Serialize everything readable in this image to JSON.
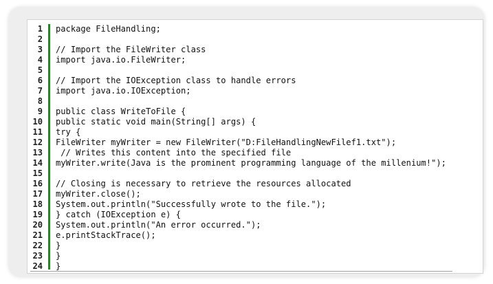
{
  "colors": {
    "frame_background": "#eeeeee",
    "code_background": "#ffffff",
    "gutter_separator": "#2e7d32",
    "text": "#111111"
  },
  "code": {
    "language": "java",
    "line_numbers": [
      "1",
      "2",
      "3",
      "4",
      "5",
      "6",
      "7",
      "8",
      "9",
      "10",
      "11",
      "12",
      "13",
      "14",
      "15",
      "16",
      "17",
      "18",
      "19",
      "20",
      "21",
      "22",
      "23",
      "24"
    ],
    "lines": [
      "package FileHandling;",
      "",
      "// Import the FileWriter class",
      "import java.io.FileWriter;",
      "",
      "// Import the IOException class to handle errors",
      "import java.io.IOException;",
      "",
      "public class WriteToFile {",
      "public static void main(String[] args) {",
      "try {",
      "FileWriter myWriter = new FileWriter(\"D:FileHandlingNewFilef1.txt\");",
      " // Writes this content into the specified file",
      "myWriter.write(Java is the prominent programming language of the millenium!\");",
      "",
      "// Closing is necessary to retrieve the resources allocated",
      "myWriter.close();",
      "System.out.println(\"Successfully wrote to the file.\");",
      "} catch (IOException e) {",
      "System.out.println(\"An error occurred.\");",
      "e.printStackTrace();",
      "}",
      "}",
      "}"
    ]
  }
}
